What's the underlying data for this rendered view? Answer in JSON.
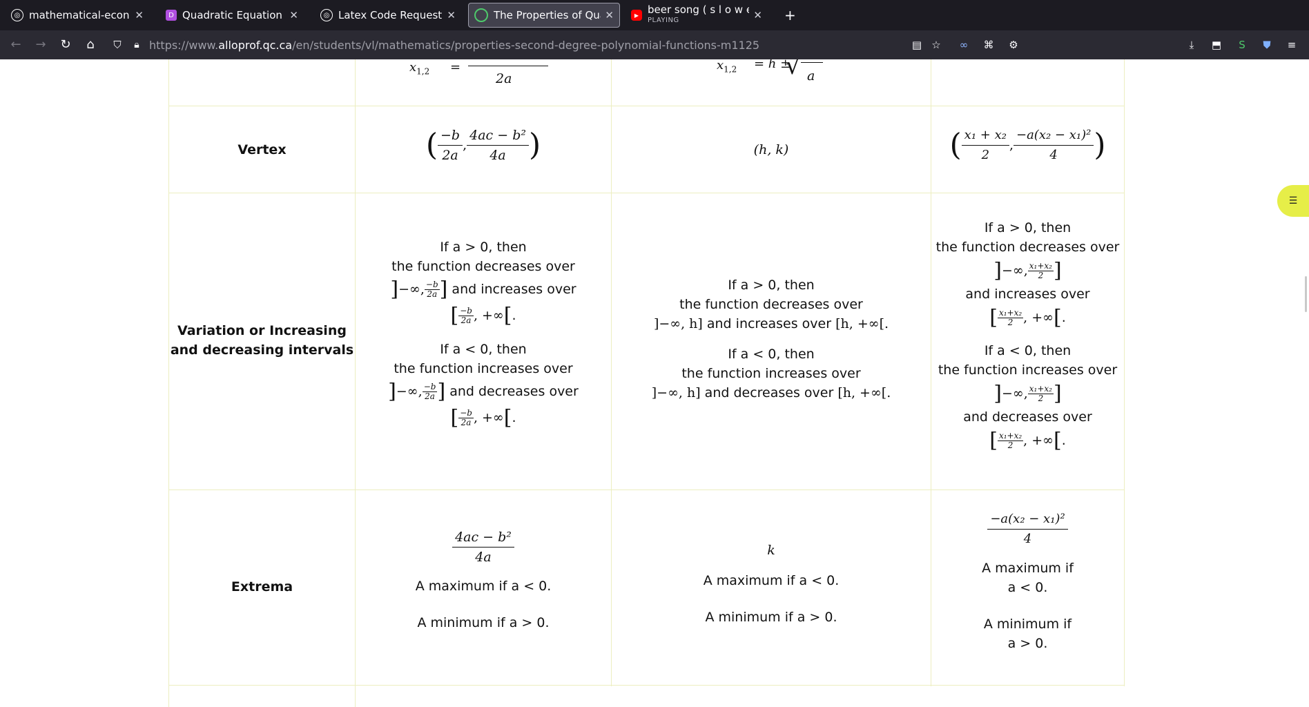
{
  "browser": {
    "tabs": [
      {
        "title": "mathematical-econ - O",
        "icon": "openai-icon",
        "color": "#ffffff"
      },
      {
        "title": "Quadratic Equation - D",
        "icon": "d-logo-icon",
        "color": "#b04fe0"
      },
      {
        "title": "Latex Code Request",
        "icon": "openai-icon",
        "color": "#ffffff"
      },
      {
        "title": "The Properties of Quad",
        "icon": "alloprof-icon",
        "color": "#4ec96b"
      },
      {
        "title": "beer song ( s l o w e d",
        "subtitle": "PLAYING",
        "icon": "youtube-icon",
        "color": "#ff0000"
      }
    ],
    "url": {
      "prefix": "https://www.",
      "host": "alloprof.qc.ca",
      "path": "/en/students/vl/mathematics/properties-second-degree-polynomial-functions-m1125"
    }
  },
  "table": {
    "top_row": {
      "col1": {
        "lhs": "x",
        "lhs_sub": "1,2",
        "den": "2a"
      },
      "col2": {
        "lhs": "x",
        "lhs_sub": "1,2",
        "rhs": "= h ±",
        "den": "a"
      }
    },
    "vertex": {
      "label": "Vertex",
      "col1": {
        "num1": "−b",
        "den1": "2a",
        "num2": "4ac − b²",
        "den2": "4a"
      },
      "col2": "(h, k)",
      "col3": {
        "num1": "x₁ + x₂",
        "den1": "2",
        "num2": "−a(x₂ − x₁)²",
        "den2": "4"
      }
    },
    "variation": {
      "label_line1": "Variation or Increasing",
      "label_line2": "and decreasing intervals",
      "if_pos": "If a > 0, then",
      "if_neg": "If a < 0, then",
      "fn_dec": "the function decreases over",
      "fn_inc": "the function increases over",
      "and_inc": "and increases over",
      "and_dec": "and decreases over",
      "inf_neg": "−∞,",
      "inf_pos": ", +∞",
      "frac_b_num": "−b",
      "frac_b_den": "2a",
      "frac_x_num": "x₁+x₂",
      "frac_x_den": "2",
      "col2_int1": "]−∞, h]",
      "col2_int2": "[h, +∞[."
    },
    "extrema": {
      "label": "Extrema",
      "col1_num": "4ac − b²",
      "col1_den": "4a",
      "col2_val": "k",
      "col3_num": "−a(x₂ − x₁)²",
      "col3_den": "4",
      "max_line": "A maximum if a < 0.",
      "min_line": "A minimum if a > 0.",
      "col3_max_a": "A maximum if",
      "col3_max_b": "a < 0.",
      "col3_min_a": "A minimum if",
      "col3_min_b": "a > 0."
    }
  }
}
